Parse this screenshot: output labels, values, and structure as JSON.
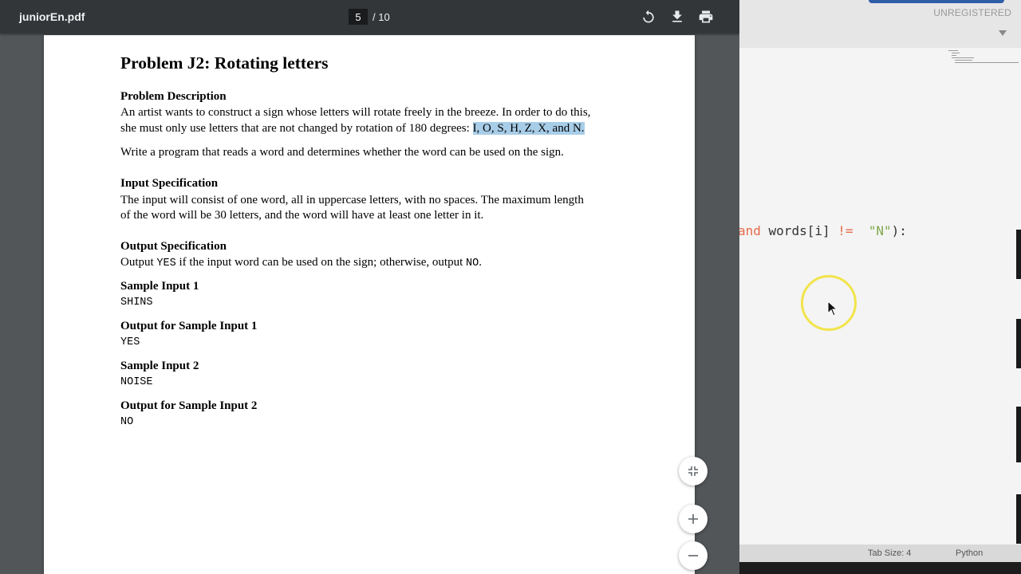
{
  "pdf_viewer": {
    "file_title": "juniorEn.pdf",
    "current_page": "5",
    "total_pages": "/ 10",
    "toolbar_icons": [
      "rotate-icon",
      "download-icon",
      "print-icon"
    ],
    "zoom_buttons": [
      "fit-page-icon",
      "zoom-in-icon",
      "zoom-out-icon"
    ]
  },
  "document": {
    "title": "Problem J2: Rotating letters",
    "problem_description": {
      "heading": "Problem Description",
      "line1": "An artist wants to construct a sign whose letters will rotate freely in the breeze. In order to do this,",
      "line2_prefix": "she must only use letters that are not changed by rotation of 180 degrees: ",
      "line2_highlight": "I, O, S, H, Z, X, and N.",
      "line3": "Write a program that reads a word and determines whether the word can be used on the sign."
    },
    "input_specification": {
      "heading": "Input Specification",
      "line1": "The input will consist of one word, all in uppercase letters, with no spaces. The maximum length",
      "line2": "of the word will be 30 letters, and the word will have at least one letter in it."
    },
    "output_specification": {
      "heading": "Output Specification",
      "prefix": "Output ",
      "yes_code": "YES",
      "middle": " if the input word can be used on the sign; otherwise, output ",
      "no_code": "NO",
      "suffix": "."
    },
    "samples": [
      {
        "heading": "Sample Input 1",
        "value": "SHINS"
      },
      {
        "heading": "Output for Sample Input 1",
        "value": "YES"
      },
      {
        "heading": "Sample Input 2",
        "value": "NOISE"
      },
      {
        "heading": "Output for Sample Input 2",
        "value": "NO"
      }
    ]
  },
  "editor": {
    "unregistered_label": "UNREGISTERED",
    "code_line": {
      "keyword": "and",
      "expr": " words[i] ",
      "operator": "!=",
      "gap": "  ",
      "string": "\"N\"",
      "tail": "):"
    },
    "status": {
      "tab_size": "Tab Size: 4",
      "language": "Python"
    }
  },
  "colors": {
    "pdf_toolbar": "#323639",
    "pdf_background": "#525659",
    "highlight": "#a8cde8",
    "editor_keyword": "#e66a4a",
    "editor_string": "#7fa84d",
    "cursor_ring": "#f1e44a"
  }
}
